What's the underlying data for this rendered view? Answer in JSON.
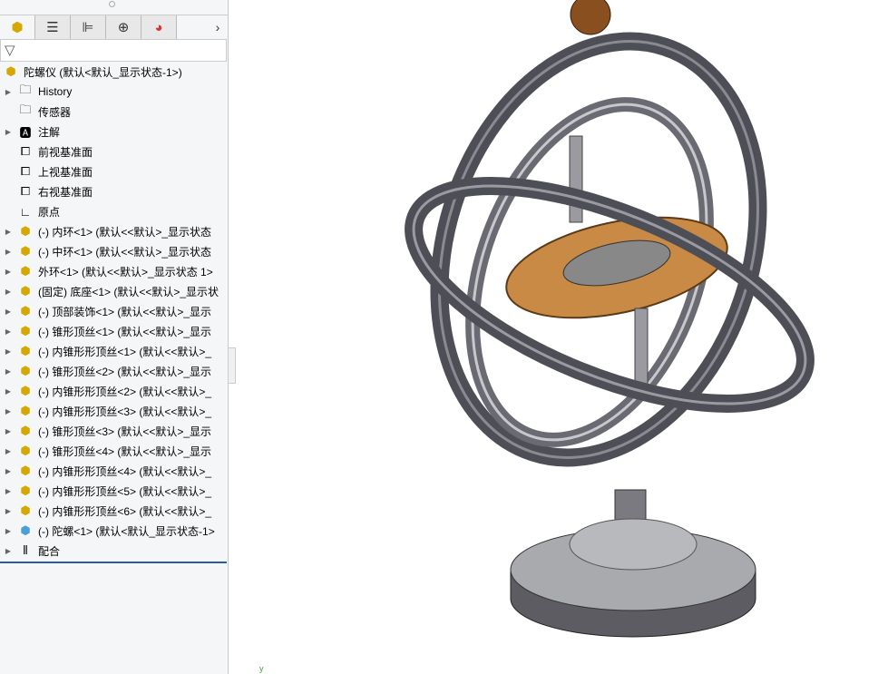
{
  "tabs": [
    {
      "name": "feature-manager",
      "icon": "assembly-icon"
    },
    {
      "name": "property-manager",
      "icon": "list-icon"
    },
    {
      "name": "configuration-manager",
      "icon": "config-icon"
    },
    {
      "name": "dimxpert",
      "icon": "crosshair-icon"
    },
    {
      "name": "display-manager",
      "icon": "appearance-icon"
    }
  ],
  "tabs_more": "›",
  "filter_icon": "▽",
  "tree": {
    "root": "陀螺仪  (默认<默认_显示状态-1>)",
    "items": [
      {
        "label": "History",
        "icon": "history-folder-icon",
        "expand": true
      },
      {
        "label": "传感器",
        "icon": "sensor-folder-icon",
        "expand": false
      },
      {
        "label": "注解",
        "icon": "annotation-folder-icon",
        "expand": true
      },
      {
        "label": "前视基准面",
        "icon": "plane-icon",
        "expand": false
      },
      {
        "label": "上视基准面",
        "icon": "plane-icon",
        "expand": false
      },
      {
        "label": "右视基准面",
        "icon": "plane-icon",
        "expand": false
      },
      {
        "label": "原点",
        "icon": "origin-icon",
        "expand": false
      },
      {
        "label": "(-) 内环<1> (默认<<默认>_显示状态",
        "icon": "part-icon",
        "expand": true
      },
      {
        "label": "(-) 中环<1> (默认<<默认>_显示状态",
        "icon": "part-icon",
        "expand": true
      },
      {
        "label": "外环<1> (默认<<默认>_显示状态 1>",
        "icon": "part-icon",
        "expand": true
      },
      {
        "label": "(固定) 底座<1> (默认<<默认>_显示状",
        "icon": "part-icon",
        "expand": true
      },
      {
        "label": "(-) 顶部装饰<1> (默认<<默认>_显示",
        "icon": "part-icon",
        "expand": true
      },
      {
        "label": "(-) 锥形顶丝<1> (默认<<默认>_显示",
        "icon": "part-icon",
        "expand": true
      },
      {
        "label": "(-) 内锥形形顶丝<1> (默认<<默认>_",
        "icon": "part-icon",
        "expand": true
      },
      {
        "label": "(-) 锥形顶丝<2> (默认<<默认>_显示",
        "icon": "part-icon",
        "expand": true
      },
      {
        "label": "(-) 内锥形形顶丝<2> (默认<<默认>_",
        "icon": "part-icon",
        "expand": true
      },
      {
        "label": "(-) 内锥形形顶丝<3> (默认<<默认>_",
        "icon": "part-icon",
        "expand": true
      },
      {
        "label": "(-) 锥形顶丝<3> (默认<<默认>_显示",
        "icon": "part-icon",
        "expand": true
      },
      {
        "label": "(-) 锥形顶丝<4> (默认<<默认>_显示",
        "icon": "part-icon",
        "expand": true
      },
      {
        "label": "(-) 内锥形形顶丝<4> (默认<<默认>_",
        "icon": "part-icon",
        "expand": true
      },
      {
        "label": "(-) 内锥形形顶丝<5> (默认<<默认>_",
        "icon": "part-icon",
        "expand": true
      },
      {
        "label": "(-) 内锥形形顶丝<6> (默认<<默认>_",
        "icon": "part-icon",
        "expand": true
      },
      {
        "label": "(-) 陀螺<1> (默认<默认_显示状态-1>",
        "icon": "subassembly-icon",
        "expand": true
      },
      {
        "label": "配合",
        "icon": "mates-icon",
        "expand": true
      }
    ]
  },
  "viewport": {
    "triad_label": "y",
    "colors": {
      "ring": "#55555d",
      "disc": "#c98a45",
      "ball": "#8a4f1e",
      "base": "#a9aaae"
    }
  }
}
